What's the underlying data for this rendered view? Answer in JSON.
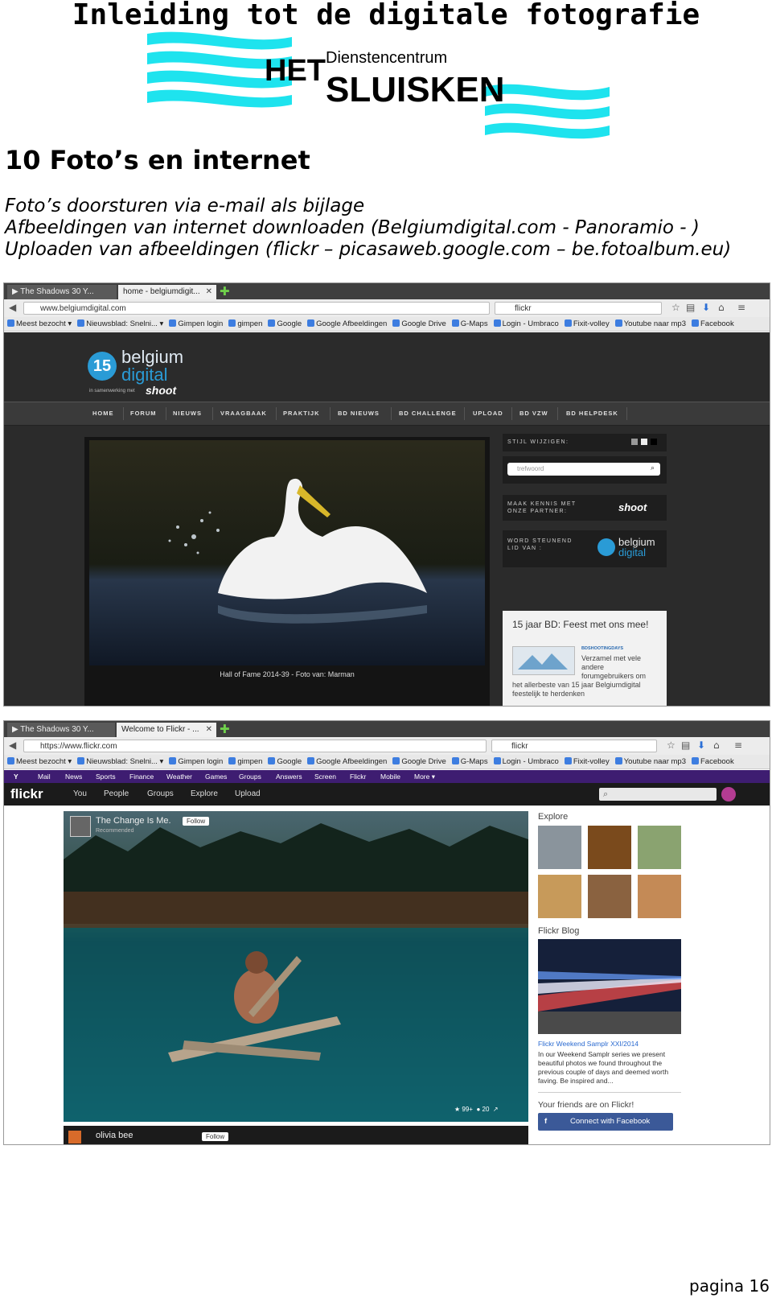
{
  "header": {
    "title": "Inleiding tot de digitale fotografie",
    "logo_text_top": "Dienstencentrum",
    "logo_text_het": "HET",
    "logo_text_main": "SLUISKEN"
  },
  "section": {
    "heading": "10 Foto’s en internet",
    "bullets": [
      "Foto’s doorsturen via e-mail als bijlage",
      "Afbeeldingen van internet downloaden (Belgiumdigital.com - Panoramio - )",
      "Uploaden van afbeeldingen (flickr – picasaweb.google.com – be.fotoalbum.eu)"
    ]
  },
  "shot1": {
    "tabs": [
      "▶ The Shadows 30 Y...",
      "home - belgiumdigit..."
    ],
    "url": "www.belgiumdigital.com",
    "search": "flickr",
    "bookmarks": [
      "Meest bezocht ▾",
      "Nieuwsblad: Snelni... ▾",
      "Gimpen login",
      "gimpen",
      "Google",
      "Google Afbeeldingen",
      "Google Drive",
      "G-Maps",
      "Login - Umbraco",
      "Fixit-volley",
      "Youtube naar mp3",
      "Facebook"
    ],
    "logo_number": "15",
    "logo_line1": "belgium",
    "logo_line2": "digital",
    "logo_sub": "in samenwerking met",
    "logo_shoot": "shoot",
    "menu": [
      "HOME",
      "FORUM",
      "NIEUWS",
      "VRAAGBAAK",
      "PRAKTIJK",
      "BD NIEUWS",
      "BD CHALLENGE",
      "UPLOAD",
      "BD VZW",
      "BD HELPDESK"
    ],
    "caption": "Hall of Fame 2014-39 - Foto van: Marman",
    "style_label": "STIJL WIJZIGEN:",
    "search_placeholder": "trefwoord",
    "partner_label_1": "MAAK KENNIS MET",
    "partner_label_2": "ONZE PARTNER:",
    "partner_logo": "shoot",
    "member_label_1": "WORD STEUNEND",
    "member_label_2": "LID VAN :",
    "member_logo_1": "belgium",
    "member_logo_2": "digital",
    "news_title": "15 jaar BD: Feest met ons mee!",
    "news_tag": "BDSHOOTINGDAYS",
    "news_text_1": "Verzamel met vele",
    "news_text_2": "andere",
    "news_text_3": "forumgebruikers om",
    "news_text_4": "het allerbeste van 15 jaar Belgiumdigital",
    "news_text_5": "feestelijk te herdenken"
  },
  "shot2": {
    "tabs": [
      "▶ The Shadows 30 Y...",
      "Welcome to Flickr - ..."
    ],
    "url": "https://www.flickr.com",
    "search": "flickr",
    "bookmarks": [
      "Meest bezocht ▾",
      "Nieuwsblad: Snelni... ▾",
      "Gimpen login",
      "gimpen",
      "Google",
      "Google Afbeeldingen",
      "Google Drive",
      "G-Maps",
      "Login - Umbraco",
      "Fixit-volley",
      "Youtube naar mp3",
      "Facebook"
    ],
    "yahoo_bar": [
      "Y",
      "Mail",
      "News",
      "Sports",
      "Finance",
      "Weather",
      "Games",
      "Groups",
      "Answers",
      "Screen",
      "Flickr",
      "Mobile",
      "More ▾"
    ],
    "logo": "flickr",
    "nav": [
      "You",
      "People",
      "Groups",
      "Explore",
      "Upload"
    ],
    "photo_user": "The Change Is Me.",
    "photo_user_sub": "Recommended",
    "follow": "Follow",
    "stat_faves": "99+",
    "stat_comments": "20",
    "second_user": "olivia bee",
    "explore_title": "Explore",
    "blog_title": "Flickr Blog",
    "blog_link": "Flickr Weekend Samplr XXI/2014",
    "blog_text_1": "In our Weekend Samplr series we present",
    "blog_text_2": "beautiful photos we found throughout the",
    "blog_text_3": "previous couple of days and deemed worth",
    "blog_text_4": "faving. Be inspired and...",
    "friends_title": "Your friends are on Flickr!",
    "connect_button": "Connect with Facebook"
  },
  "footer": {
    "page": "pagina 16"
  }
}
